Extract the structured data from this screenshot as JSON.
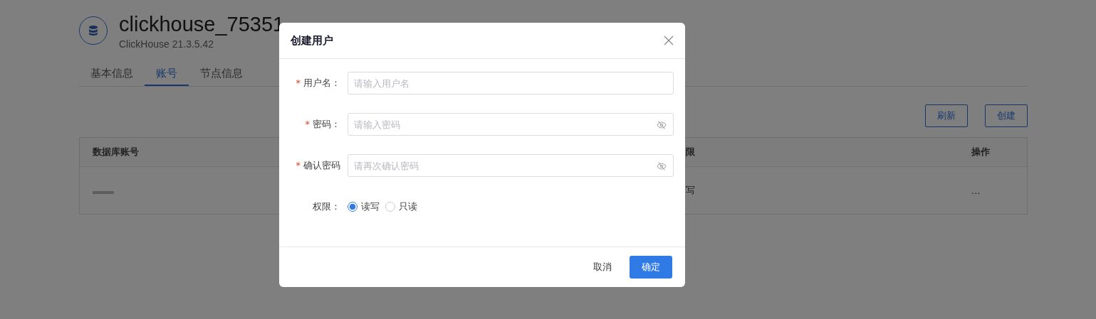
{
  "page": {
    "title": "clickhouse_75351",
    "subtitle": "ClickHouse 21.3.5.42",
    "tabs": [
      {
        "label": "基本信息",
        "selected": false
      },
      {
        "label": "账号",
        "selected": true
      },
      {
        "label": "节点信息",
        "selected": false
      }
    ],
    "buttons": [
      "刷新",
      "创建"
    ],
    "table": {
      "columns": [
        "数据库账号",
        "限",
        "操作"
      ],
      "rows": [
        {
          "permission": "写",
          "action": "..."
        }
      ]
    }
  },
  "dialog": {
    "title": "创建用户",
    "fields": [
      {
        "kind": "text",
        "label": "用户名：",
        "required_mark": "*",
        "placeholder": "请输入用户名"
      },
      {
        "kind": "password",
        "label": "密码：",
        "required_mark": "*",
        "placeholder": "请输入密码"
      },
      {
        "kind": "password",
        "label": "确认密码",
        "required_mark": "*",
        "placeholder": "请再次确认密码"
      }
    ],
    "permission": {
      "label": "权限：",
      "options": [
        {
          "label": "读写",
          "selected": true
        },
        {
          "label": "只读",
          "selected": false
        }
      ]
    },
    "buttons": [
      {
        "kind": "cancel",
        "label": "取消"
      },
      {
        "kind": "primary",
        "label": "确定"
      }
    ]
  }
}
